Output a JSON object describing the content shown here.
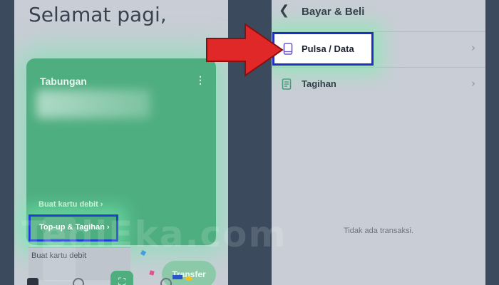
{
  "left_screen": {
    "greeting": "Selamat pagi,",
    "card": {
      "title": "Tabungan",
      "menu_icon": "more-vertical-icon",
      "debit_link": "Buat kartu debit ›",
      "topup_label": "Top-up & Tagihan ›",
      "transfer_label": "Transfer"
    },
    "bottom_banner": "Buat kartu debit"
  },
  "right_screen": {
    "header_title": "Bayar & Beli",
    "rows": [
      {
        "label": "Pulsa / Data",
        "icon": "phone-icon"
      },
      {
        "label": "Tagihan",
        "icon": "receipt-icon"
      }
    ],
    "empty_state": "Tidak ada transaksi."
  },
  "annotation": {
    "arrow_color": "#e02828",
    "highlight_color": "#1f3fcf",
    "watermark": "TediEka.com"
  },
  "colors": {
    "card_green": "#4fae80",
    "background": "#c9ced6"
  }
}
